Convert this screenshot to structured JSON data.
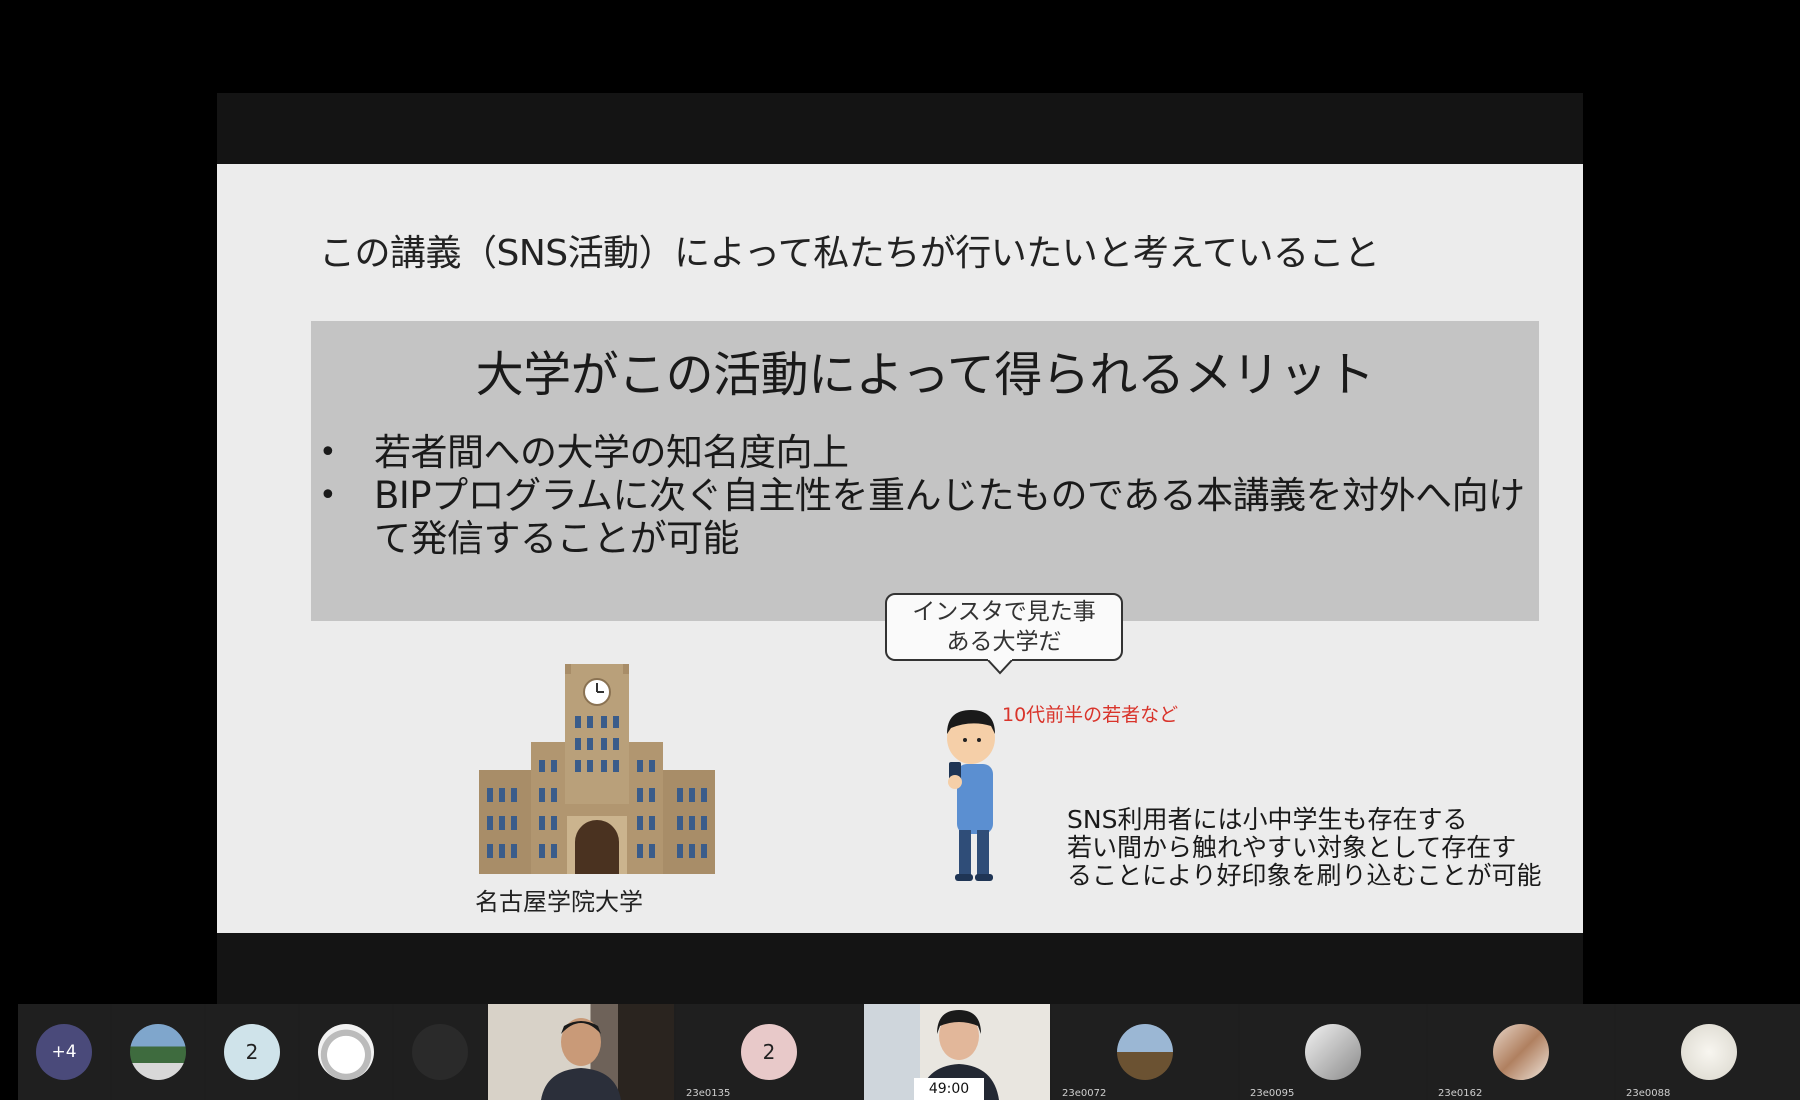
{
  "slide": {
    "title": "この講義（SNS活動）によって私たちが行いたいと考えていること",
    "box_heading": "大学がこの活動によって得られるメリット",
    "bullet_symbol": "•",
    "bullets": [
      "若者間への大学の知名度向上",
      "BIPプログラムに次ぐ自主性を重んじたものである本講義を対外へ向けて発信することが可能"
    ],
    "university_label": "名古屋学院大学",
    "speech_bubble": [
      "インスタで見た事",
      "ある大学だ"
    ],
    "teen_note": "10代前半の若者など",
    "sns_note": [
      "SNS利用者には小中学生も存在する",
      "若い間から触れやすい対象として存在す",
      "ることにより好印象を刷り込むことが可能"
    ],
    "teen_note_color": "#d9342b"
  },
  "participants": [
    {
      "kind": "count",
      "text": "+4",
      "color": "#4a4a7a"
    },
    {
      "kind": "photo",
      "icon": "stadium-photo-avatar"
    },
    {
      "kind": "initial",
      "text": "2",
      "color": "#cfe3ea"
    },
    {
      "kind": "photo",
      "icon": "drawn-face-avatar"
    },
    {
      "kind": "photo",
      "icon": "dark-avatar"
    },
    {
      "kind": "video",
      "icon": "presenter-video"
    },
    {
      "kind": "initial",
      "text": "2",
      "color": "#e8c9c9",
      "name": "23e0135"
    },
    {
      "kind": "video",
      "icon": "student-video",
      "timer": "49:00"
    },
    {
      "kind": "photo",
      "icon": "landscape-avatar",
      "name": "23e0072"
    },
    {
      "kind": "photo",
      "icon": "silver-avatar",
      "name": "23e0095"
    },
    {
      "kind": "photo",
      "icon": "group-photo-avatar",
      "name": "23e0162"
    },
    {
      "kind": "photo",
      "icon": "light-avatar",
      "name": "23e0088"
    }
  ]
}
